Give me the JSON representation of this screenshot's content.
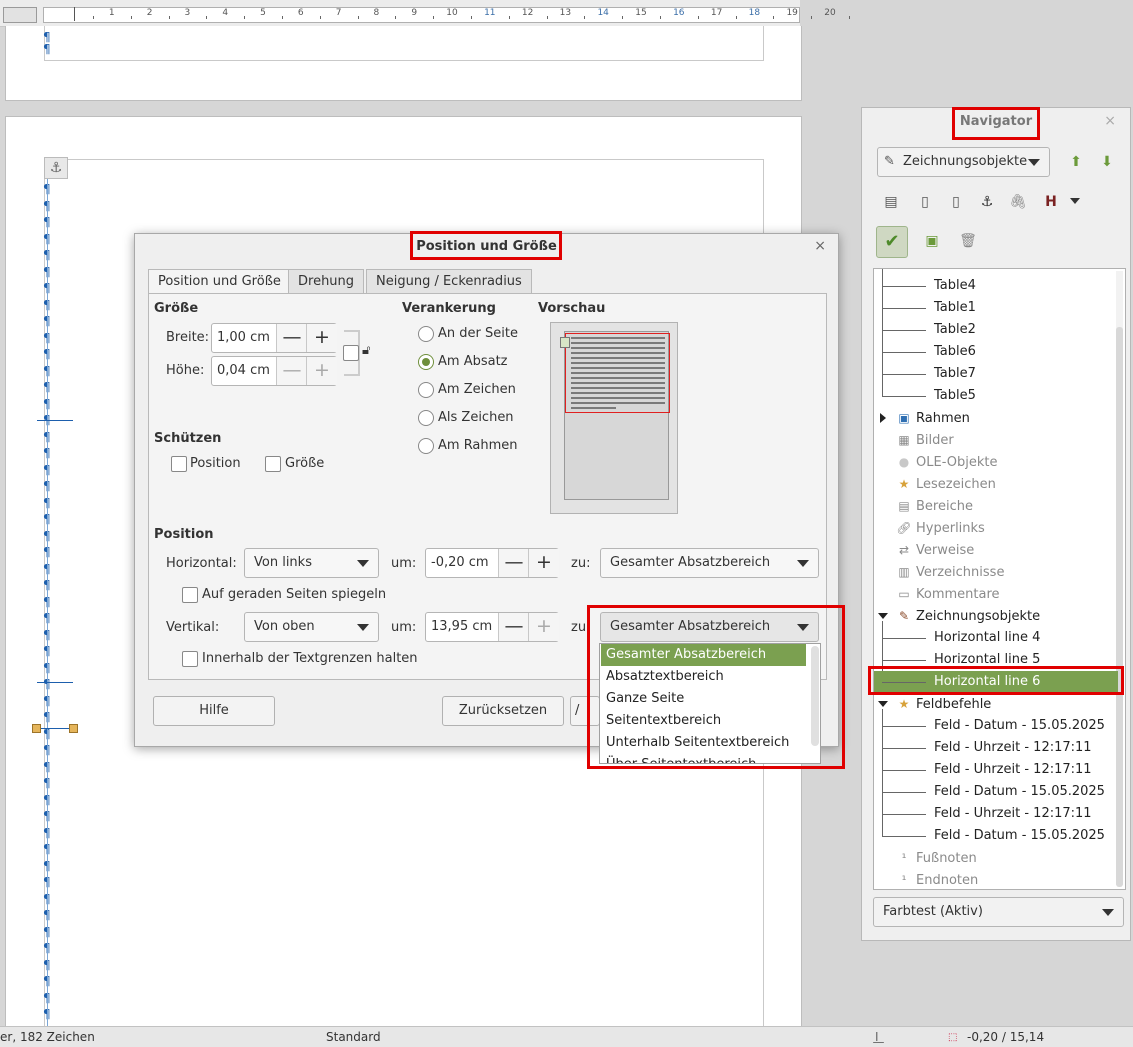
{
  "ruler": {
    "labels": [
      "1",
      "2",
      "3",
      "4",
      "5",
      "6",
      "7",
      "8",
      "9",
      "10",
      "11",
      "12",
      "13",
      "14",
      "15",
      "16",
      "17",
      "18",
      "19",
      "20"
    ]
  },
  "document": {
    "pilcrow": "¶",
    "anchor_icon": "anchor-icon"
  },
  "dialog": {
    "title": "Position und Größe",
    "close_icon": "×",
    "tabs": [
      "Position und Größe",
      "Drehung",
      "Neigung / Eckenradius"
    ],
    "size": {
      "heading": "Größe",
      "width_label": "Breite:",
      "width_value": "1,00 cm",
      "height_label": "Höhe:",
      "height_value": "0,04 cm",
      "minus": "—",
      "plus": "+"
    },
    "anchor": {
      "heading": "Verankerung",
      "options": [
        "An der Seite",
        "Am Absatz",
        "Am Zeichen",
        "Als Zeichen",
        "Am Rahmen"
      ],
      "selected": "Am Absatz"
    },
    "preview": {
      "heading": "Vorschau"
    },
    "protect": {
      "heading": "Schützen",
      "position_label": "Position",
      "size_label": "Größe"
    },
    "position": {
      "heading": "Position",
      "horizontal_label": "Horizontal:",
      "horizontal_value": "Von links",
      "h_by_label": "um:",
      "h_by_value": "-0,20 cm",
      "h_to_label": "zu:",
      "h_to_value": "Gesamter Absatzbereich",
      "mirror_label": "Auf geraden Seiten spiegeln",
      "vertical_label": "Vertikal:",
      "vertical_value": "Von oben",
      "v_by_label": "um:",
      "v_by_value": "13,95 cm",
      "v_to_label": "zu:",
      "v_to_value": "Gesamter Absatzbereich",
      "keep_inside_label": "Innerhalb der Textgrenzen halten"
    },
    "dropdown_items": [
      "Gesamter Absatzbereich",
      "Absatztextbereich",
      "Ganze Seite",
      "Seitentextbereich",
      "Unterhalb Seitentextbereich",
      "Über Seitentextbereich"
    ],
    "dropdown_selected": "Gesamter Absatzbereich",
    "buttons": {
      "help": "Hilfe",
      "reset": "Zurücksetzen",
      "ok_partial": "/"
    }
  },
  "navigator": {
    "title": "Navigator",
    "close_icon": "×",
    "category_select": "Zeichnungsobjekte",
    "up_icon": "⬆",
    "down_icon": "⬇",
    "tree": [
      {
        "label": "Table4"
      },
      {
        "label": "Table1"
      },
      {
        "label": "Table2"
      },
      {
        "label": "Table6"
      },
      {
        "label": "Table7"
      },
      {
        "label": "Table5"
      },
      {
        "label": "Rahmen"
      },
      {
        "label": "Bilder"
      },
      {
        "label": "OLE-Objekte"
      },
      {
        "label": "Lesezeichen"
      },
      {
        "label": "Bereiche"
      },
      {
        "label": "Hyperlinks"
      },
      {
        "label": "Verweise"
      },
      {
        "label": "Verzeichnisse"
      },
      {
        "label": "Kommentare"
      },
      {
        "label": "Zeichnungsobjekte"
      },
      {
        "label": "Horizontal line 4"
      },
      {
        "label": "Horizontal line 5"
      },
      {
        "label": "Horizontal line 6"
      },
      {
        "label": "Feldbefehle"
      },
      {
        "label": "Feld - Datum - 15.05.2025"
      },
      {
        "label": "Feld - Uhrzeit - 12:17:11"
      },
      {
        "label": "Feld - Uhrzeit - 12:17:11"
      },
      {
        "label": "Feld - Datum - 15.05.2025"
      },
      {
        "label": "Feld - Uhrzeit - 12:17:11"
      },
      {
        "label": "Feld - Datum - 15.05.2025"
      },
      {
        "label": "Fußnoten"
      },
      {
        "label": "Endnoten"
      }
    ],
    "selected_item": "Horizontal line 6",
    "document_select": "Farbtest (Aktiv)"
  },
  "statusbar": {
    "word_count": "er, 182 Zeichen",
    "page_style": "Standard",
    "position": "-0,20 / 15,14"
  },
  "colors": {
    "highlight_green": "#7ba050",
    "annotation_red": "#e00000"
  }
}
